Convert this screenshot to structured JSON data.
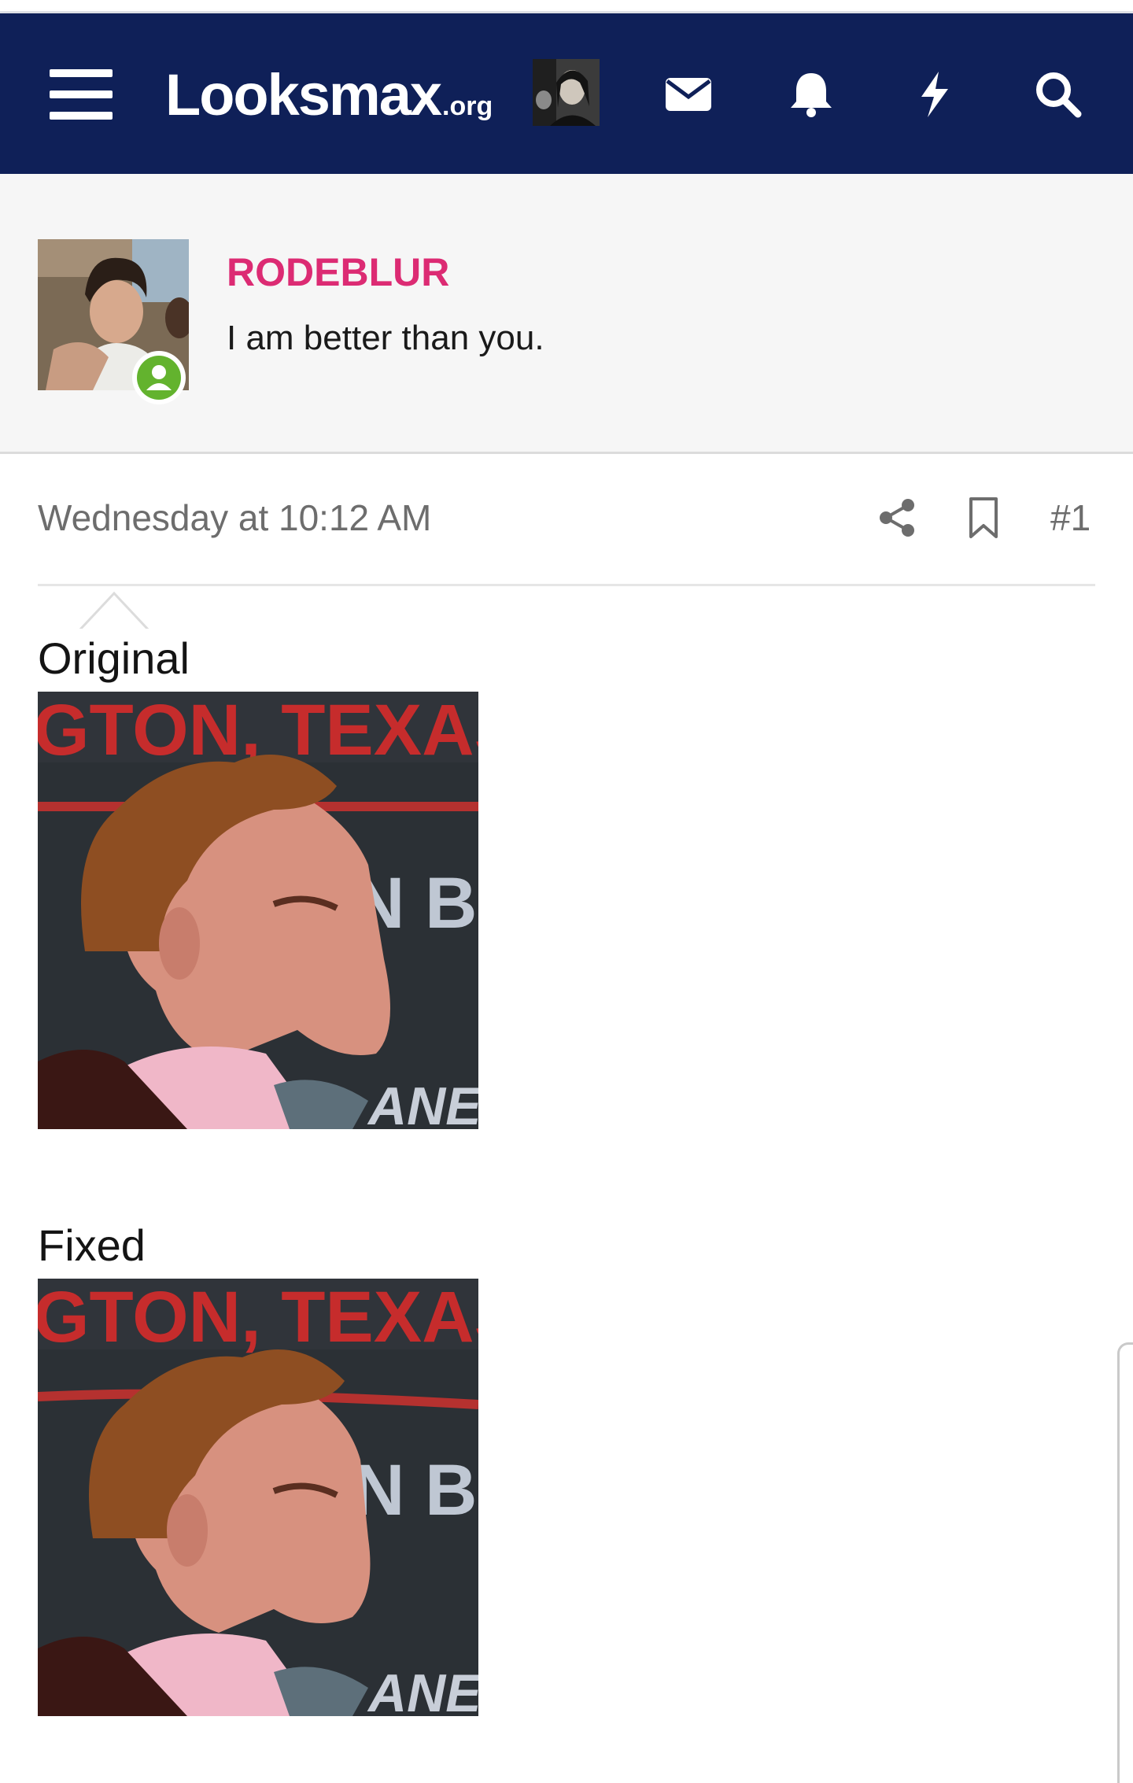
{
  "header": {
    "menu_icon": "hamburger-menu-icon",
    "logo_text": "Looksmax",
    "logo_suffix": ".org",
    "icons": [
      "envelope-icon",
      "bell-icon",
      "lightning-icon",
      "search-icon"
    ],
    "background_color": "#0f2058"
  },
  "profile": {
    "username": "RODEBLUR",
    "user_title": "I am better than you.",
    "username_color": "#dc2b73",
    "online_status": "online"
  },
  "post": {
    "timestamp": "Wednesday at 10:12 AM",
    "post_number": "#1",
    "sections": [
      {
        "caption": "Original",
        "image_text_top": "GTON, TEXAS,",
        "image_text_mid": "N BO",
        "image_text_bottom": "ANE"
      },
      {
        "caption": "Fixed",
        "image_text_top": "GTON, TEXAS,",
        "image_text_mid": "N BO",
        "image_text_bottom": "ANE"
      }
    ]
  }
}
